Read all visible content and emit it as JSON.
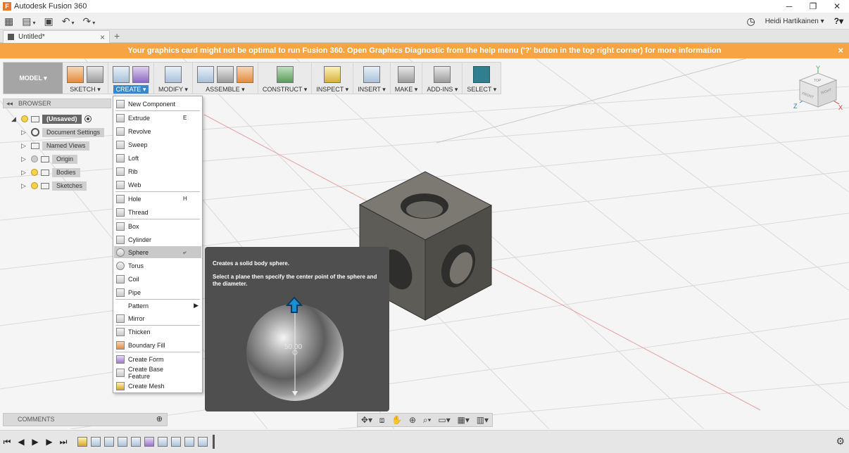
{
  "window": {
    "title": "Autodesk Fusion 360",
    "logo_letter": "F",
    "controls": {
      "minimize": "─",
      "restore": "❐",
      "close": "✕"
    }
  },
  "qat": {
    "grid_icon": "▦",
    "file_icon": "▤",
    "save_icon": "▣",
    "undo_icon": "↶",
    "redo_icon": "↷",
    "caret": "▾",
    "clock_icon": "◷",
    "user": "Heidi Hartikainen ▾",
    "help_icon": "?▾"
  },
  "tabs": {
    "document": "Untitled*",
    "close": "×",
    "new": "+"
  },
  "banner": {
    "message": "Your graphics card might not be optimal to run Fusion 360. Open Graphics Diagnostic from the help menu ('?' button in the top right corner) for more information",
    "close": "×"
  },
  "toolbar": {
    "workspace": "MODEL ▾",
    "groups": [
      {
        "label": "SKETCH ▾"
      },
      {
        "label": "CREATE ▾"
      },
      {
        "label": "MODIFY ▾"
      },
      {
        "label": "ASSEMBLE ▾"
      },
      {
        "label": "CONSTRUCT ▾"
      },
      {
        "label": "INSPECT ▾"
      },
      {
        "label": "INSERT ▾"
      },
      {
        "label": "MAKE ▾"
      },
      {
        "label": "ADD-INS ▾"
      },
      {
        "label": "SELECT ▾"
      }
    ]
  },
  "browser": {
    "collapse": "◂◂",
    "title": "BROWSER",
    "root": "(Unsaved)",
    "nodes": [
      "Document Settings",
      "Named Views",
      "Origin",
      "Bodies",
      "Sketches"
    ]
  },
  "create_menu": {
    "items": [
      {
        "label": "New Component",
        "shortcut": ""
      },
      {
        "label": "Extrude",
        "shortcut": "E"
      },
      {
        "label": "Revolve",
        "shortcut": ""
      },
      {
        "label": "Sweep",
        "shortcut": ""
      },
      {
        "label": "Loft",
        "shortcut": ""
      },
      {
        "label": "Rib",
        "shortcut": ""
      },
      {
        "label": "Web",
        "shortcut": ""
      },
      {
        "label": "Hole",
        "shortcut": "H"
      },
      {
        "label": "Thread",
        "shortcut": ""
      },
      {
        "label": "Box",
        "shortcut": ""
      },
      {
        "label": "Cylinder",
        "shortcut": ""
      },
      {
        "label": "Sphere",
        "shortcut": "⤶"
      },
      {
        "label": "Torus",
        "shortcut": ""
      },
      {
        "label": "Coil",
        "shortcut": ""
      },
      {
        "label": "Pipe",
        "shortcut": ""
      },
      {
        "label": "Pattern",
        "shortcut": "▶"
      },
      {
        "label": "Mirror",
        "shortcut": ""
      },
      {
        "label": "Thicken",
        "shortcut": ""
      },
      {
        "label": "Boundary Fill",
        "shortcut": ""
      },
      {
        "label": "Create Form",
        "shortcut": ""
      },
      {
        "label": "Create Base Feature",
        "shortcut": ""
      },
      {
        "label": "Create Mesh",
        "shortcut": ""
      }
    ]
  },
  "tooltip": {
    "title": "Creates a solid body sphere.",
    "description": "Select a plane then specify the center point of the sphere and the diameter.",
    "dimension": "50.00"
  },
  "viewcube": {
    "axis_y": "Y",
    "axis_z": "Z",
    "axis_x": "X",
    "face_top": "TOP",
    "face_front": "FRONT",
    "face_right": "RIGHT"
  },
  "comments": {
    "title": "COMMENTS",
    "add": "⊕"
  },
  "navbar": {
    "orbit": "✥▾",
    "lookat": "⧈",
    "pan": "✋",
    "zoom": "⊕",
    "zoomwin": "⌕▾",
    "display": "▭▾",
    "grid": "▦▾",
    "viewports": "▥▾"
  },
  "timeline": {
    "first": "⏮",
    "prev": "◀",
    "play": "▶",
    "next": "▶",
    "last": "⏭",
    "settings": "⚙"
  },
  "colors": {
    "banner": "#f7a544",
    "accent": "#3a86c8",
    "cube": "#5a5853"
  }
}
